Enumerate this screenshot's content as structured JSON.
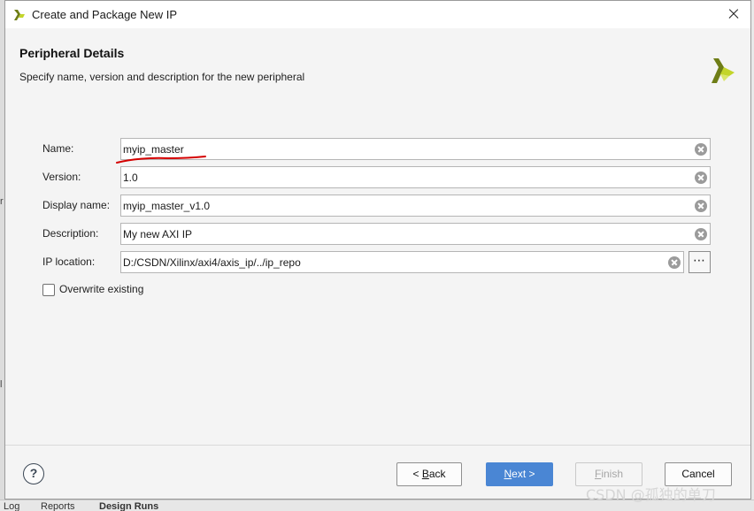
{
  "window": {
    "title": "Create and Package New IP",
    "logo_icon": "xilinx-logo-icon",
    "close_icon": "close-icon"
  },
  "header": {
    "title": "Peripheral Details",
    "subtitle": "Specify name, version and description for the new peripheral",
    "logo_icon": "xilinx-logo-icon"
  },
  "form": {
    "name": {
      "label": "Name:",
      "value": "myip_master"
    },
    "version": {
      "label": "Version:",
      "value": "1.0"
    },
    "display_name": {
      "label": "Display name:",
      "value": "myip_master_v1.0"
    },
    "description": {
      "label": "Description:",
      "value": "My new AXI IP"
    },
    "ip_location": {
      "label": "IP location:",
      "value": "D:/CSDN/Xilinx/axi4/axis_ip/../ip_repo",
      "browse_label": "⋯"
    },
    "overwrite": {
      "label": "Overwrite existing",
      "checked": false
    }
  },
  "footer": {
    "help_label": "?",
    "back": {
      "prefix": "< ",
      "mnemonic": "B",
      "rest": "ack"
    },
    "next": {
      "mnemonic": "N",
      "rest": "ext >"
    },
    "finish": {
      "mnemonic": "F",
      "rest": "inish",
      "enabled": false
    },
    "cancel_label": "Cancel"
  },
  "background": {
    "left_marks": [
      "r",
      "l"
    ],
    "bottom_tabs": [
      "Log",
      "Reports",
      "Design Runs"
    ]
  },
  "watermark": "CSDN @孤独的单刀",
  "colors": {
    "accent": "#4a86d4",
    "logo_dark": "#6e7d16",
    "logo_light": "#c3d52a",
    "annotation_red": "#d40000"
  }
}
